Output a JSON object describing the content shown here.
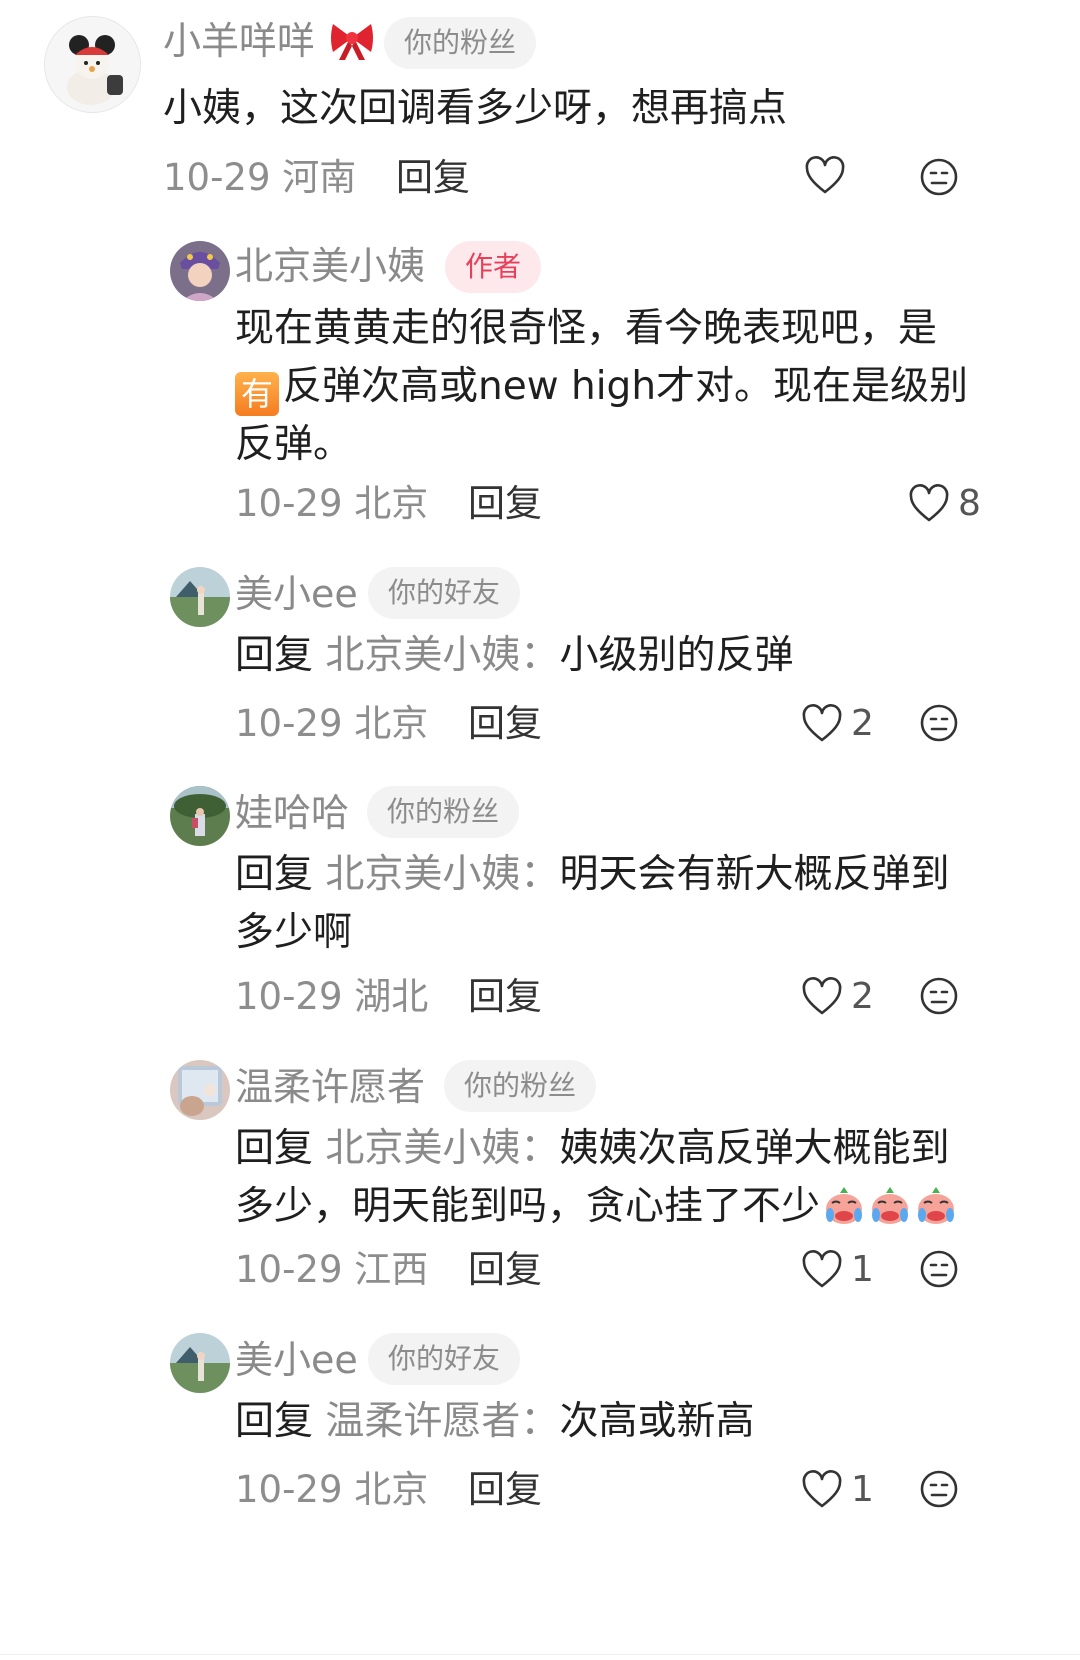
{
  "comments": [
    {
      "username": "小羊咩咩",
      "badge": "你的粉丝",
      "text": "小姨，这次回调看多少呀，想再搞点",
      "date": "10-29",
      "location": "河南",
      "reply_label": "回复"
    },
    {
      "username": "北京美小姨",
      "badge": "作者",
      "text_lines": [
        "现在黄黄走的很奇怪，看今晚表现吧，是",
        "反弹次高或new high才对。现在是级别",
        "反弹。"
      ],
      "inline_tag": "有",
      "date": "10-29",
      "location": "北京",
      "reply_label": "回复",
      "likes": "8"
    },
    {
      "username": "美小ee",
      "badge": "你的好友",
      "reply_prefix": "回复",
      "reply_target": "北京美小姨：",
      "text": "小级别的反弹",
      "date": "10-29",
      "location": "北京",
      "reply_label": "回复",
      "likes": "2"
    },
    {
      "username": "娃哈哈",
      "badge": "你的粉丝",
      "reply_prefix": "回复",
      "reply_target": "北京美小姨：",
      "text_lines": [
        "明天会有新大概反弹到",
        "多少啊"
      ],
      "date": "10-29",
      "location": "湖北",
      "reply_label": "回复",
      "likes": "2"
    },
    {
      "username": "温柔许愿者",
      "badge": "你的粉丝",
      "reply_prefix": "回复",
      "reply_target": "北京美小姨：",
      "text_lines": [
        "姨姨次高反弹大概能到",
        "多少，明天能到吗，贪心挂了不少"
      ],
      "date": "10-29",
      "location": "江西",
      "reply_label": "回复",
      "likes": "1"
    },
    {
      "username": "美小ee",
      "badge": "你的好友",
      "reply_prefix": "回复",
      "reply_target": "温柔许愿者：",
      "text": "次高或新高",
      "date": "10-29",
      "location": "北京",
      "reply_label": "回复",
      "likes": "1"
    }
  ],
  "icons": {
    "like": "heart-outline-icon",
    "dislike": "neutral-face-icon",
    "bow": "red-bow-icon",
    "cry": "crying-emoji-icon"
  },
  "colors": {
    "author_badge_text": "#e6405a",
    "author_badge_bg": "#fde9ec",
    "username": "#8a8a8a",
    "body_text": "#1f1f1f"
  }
}
